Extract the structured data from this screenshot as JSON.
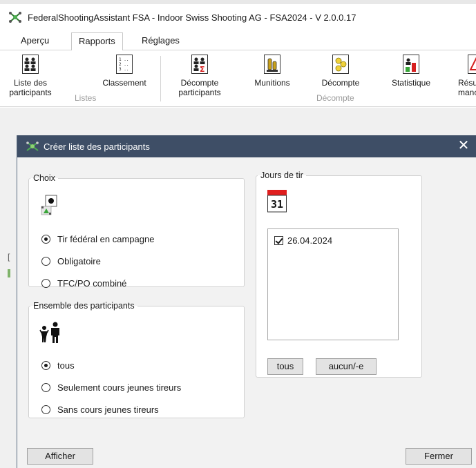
{
  "window": {
    "title": "FederalShootingAssistant FSA - Indoor Swiss Shooting AG - FSA2024 - V 2.0.0.17",
    "logo_icon": "fsa-logo-icon"
  },
  "tabs": [
    {
      "label": "Aperçu",
      "active": false
    },
    {
      "label": "Rapports",
      "active": true
    },
    {
      "label": "Réglages",
      "active": false
    }
  ],
  "ribbon": {
    "buttons": [
      {
        "label_line1": "Liste des",
        "label_line2": "participants",
        "icon": "participants-list-icon"
      },
      {
        "label_line1": "Classement",
        "label_line2": "",
        "icon": "ranking-list-icon"
      },
      {
        "label_line1": "Décompte",
        "label_line2": "participants",
        "icon": "participants-settlement-icon"
      },
      {
        "label_line1": "Munitions",
        "label_line2": "",
        "icon": "ammunition-icon"
      },
      {
        "label_line1": "Décompte",
        "label_line2": "",
        "icon": "settlement-icon"
      },
      {
        "label_line1": "Statistique",
        "label_line2": "",
        "icon": "statistics-icon"
      },
      {
        "label_line1": "Résu",
        "label_line2": "manc",
        "icon": "summary-icon"
      }
    ],
    "groups": [
      {
        "label": "Listes"
      },
      {
        "label": "Décompte"
      }
    ]
  },
  "dialog": {
    "title": "Créer liste des participants",
    "close_glyph": "✕",
    "choix": {
      "legend": "Choix",
      "icon": "shooting-target-icon",
      "options": [
        {
          "label": "Tir fédéral en campagne",
          "selected": true
        },
        {
          "label": "Obligatoire",
          "selected": false
        },
        {
          "label": "TFC/PO combiné",
          "selected": false
        }
      ]
    },
    "ensemble": {
      "legend": "Ensemble des participants",
      "icon": "adult-child-icon",
      "options": [
        {
          "label": "tous",
          "selected": true
        },
        {
          "label": "Seulement cours jeunes tireurs",
          "selected": false
        },
        {
          "label": "Sans cours jeunes tireurs",
          "selected": false
        }
      ]
    },
    "jours": {
      "legend": "Jours de tir",
      "calendar_day": "31",
      "dates": [
        {
          "label": "26.04.2024",
          "checked": true
        }
      ],
      "btn_all": "tous",
      "btn_none": "aucun/-e"
    },
    "footer": {
      "show_label": "Afficher",
      "close_label": "Fermer"
    }
  },
  "colors": {
    "dialog_header": "#3e4e66",
    "calendar_red": "#e01e1e"
  }
}
